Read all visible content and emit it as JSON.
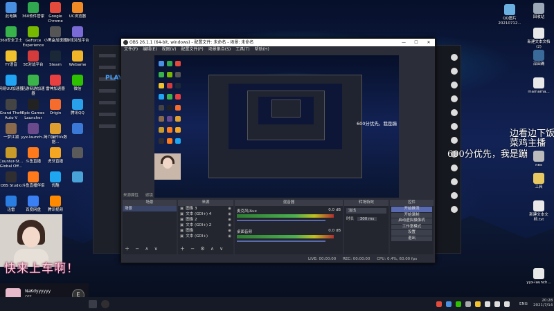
{
  "desktop": {
    "left_icons": [
      {
        "label": "此电脑",
        "color": "#4a90e2"
      },
      {
        "label": "360软件管家",
        "color": "#2fa84f"
      },
      {
        "label": "Google Chrome",
        "color": "#e24a3b"
      },
      {
        "label": "UC浏览器",
        "color": "#f08a24"
      },
      {
        "label": "360安全卫士",
        "color": "#38b24a"
      },
      {
        "label": "GeForce Experience",
        "color": "#76b900"
      },
      {
        "label": "小黑盒加速器",
        "color": "#555555"
      },
      {
        "label": "游戏对战平台",
        "color": "#7a6ad6"
      },
      {
        "label": "YY语音",
        "color": "#f2c12e"
      },
      {
        "label": "5E对战平台",
        "color": "#d43b3b"
      },
      {
        "label": "Steam",
        "color": "#1b2838"
      },
      {
        "label": "WeGame",
        "color": "#f0b429"
      },
      {
        "label": "网易UU加速器",
        "color": "#20a4f3"
      },
      {
        "label": "迅游网游加速器",
        "color": "#3bb54a"
      },
      {
        "label": "雷神加速器",
        "color": "#e84040"
      },
      {
        "label": "微信",
        "color": "#2dc100"
      },
      {
        "label": "Grand Theft Auto V",
        "color": "#444444"
      },
      {
        "label": "Epic Games Launcher",
        "color": "#222222"
      },
      {
        "label": "Origin",
        "color": "#f56c2d"
      },
      {
        "label": "腾讯QQ",
        "color": "#29a0ea"
      },
      {
        "label": "一梦江湖",
        "color": "#8a6a4a"
      },
      {
        "label": "yyx-launch...",
        "color": "#6a4a8a"
      },
      {
        "label": "简介操作Vs数据...",
        "color": "#e0a030"
      },
      {
        "label": "",
        "color": "#3a7ad6"
      },
      {
        "label": "Counter-St... Global Off...",
        "color": "#c99b28"
      },
      {
        "label": "斗鱼直播",
        "color": "#ff7a1a"
      },
      {
        "label": "虎牙直播",
        "color": "#f5a623"
      },
      {
        "label": "",
        "color": "#5a5a5a"
      },
      {
        "label": "OBS Studio",
        "color": "#302e31"
      },
      {
        "label": "斗鱼直播伴侣",
        "color": "#ff7a1a"
      },
      {
        "label": "优酷",
        "color": "#1ea6f0"
      },
      {
        "label": "",
        "color": "#4aa3d6"
      },
      {
        "label": "迅雷",
        "color": "#2a7de1"
      },
      {
        "label": "百度网盘",
        "color": "#3b7ff5"
      },
      {
        "label": "腾讯视频",
        "color": "#ff8a00"
      }
    ],
    "right_icons": [
      {
        "label": "QQ图片 20210712...",
        "color": "#6ab0e0"
      },
      {
        "label": "回收站",
        "color": "#9aa8b8"
      },
      {
        "label": "新建文本文档 (2)",
        "color": "#e8e8e8"
      },
      {
        "label": "深田确",
        "color": "#3a6a9a"
      },
      {
        "label": "mamama...",
        "color": "#e8e8e8"
      },
      {
        "label": "nes",
        "color": "#bbbbbb"
      },
      {
        "label": "工具",
        "color": "#e8c860"
      },
      {
        "label": "新建文本文档.txt",
        "color": "#e8e8e8"
      },
      {
        "label": "yyx-launch...",
        "color": "#e8e8e8"
      }
    ]
  },
  "launcher": {
    "play_label": "PLAY"
  },
  "obs": {
    "title": "OBS 26.1.1 (64-bit, windows) - 配置文件: 未命名 - 场景: 未命名",
    "window_controls": [
      "—",
      "☐",
      "✕"
    ],
    "menu": [
      "文件(F)",
      "编辑(E)",
      "视图(V)",
      "配置文件(P)",
      "场景集合(S)",
      "工具(T)",
      "帮助(H)"
    ],
    "preview_overlay_text": [
      "600分优先，我是蹦"
    ],
    "source_tabs": [
      "来源属性",
      "滤镜"
    ],
    "panels": {
      "scenes": {
        "header": "场景",
        "items": [
          "场景"
        ]
      },
      "sources": {
        "header": "来源",
        "items": [
          "图像 3",
          "文本 (GDI+) 4",
          "图像 2",
          "文本 (GDI+) 2",
          "图像",
          "文本 (GDI+)"
        ]
      },
      "mixer": {
        "header": "混音器",
        "tracks": [
          {
            "name": "麦克风/Aux",
            "db": "0.0 dB"
          },
          {
            "name": "桌面音频",
            "db": "0.0 dB"
          }
        ]
      },
      "transitions": {
        "header": "转场特效",
        "type": "淡出",
        "duration_label": "时长",
        "duration": "300 ms"
      },
      "controls": {
        "header": "控件",
        "buttons": [
          "开始推流",
          "开始录制",
          "启动虚拟摄像机",
          "工作室模式",
          "设置",
          "退出"
        ],
        "active_index": 0
      }
    },
    "status": {
      "live": "LIVE: 00:00:00",
      "rec": "REC: 00:00:00",
      "cpu": "CPU: 0.4%, 60.00 fps"
    }
  },
  "stream_overlay": {
    "caption": "快来上车啊！",
    "profile_name": "NaKdyyyyyy",
    "profile_sub": "OFF",
    "e_badge": "E",
    "danmu": [
      "边看边下饭",
      "菜鸡主播",
      "600分优先，我是蹦"
    ]
  },
  "taskbar": {
    "tray_lang": "ENG",
    "time": "20:28",
    "date": "2021/7/14"
  }
}
